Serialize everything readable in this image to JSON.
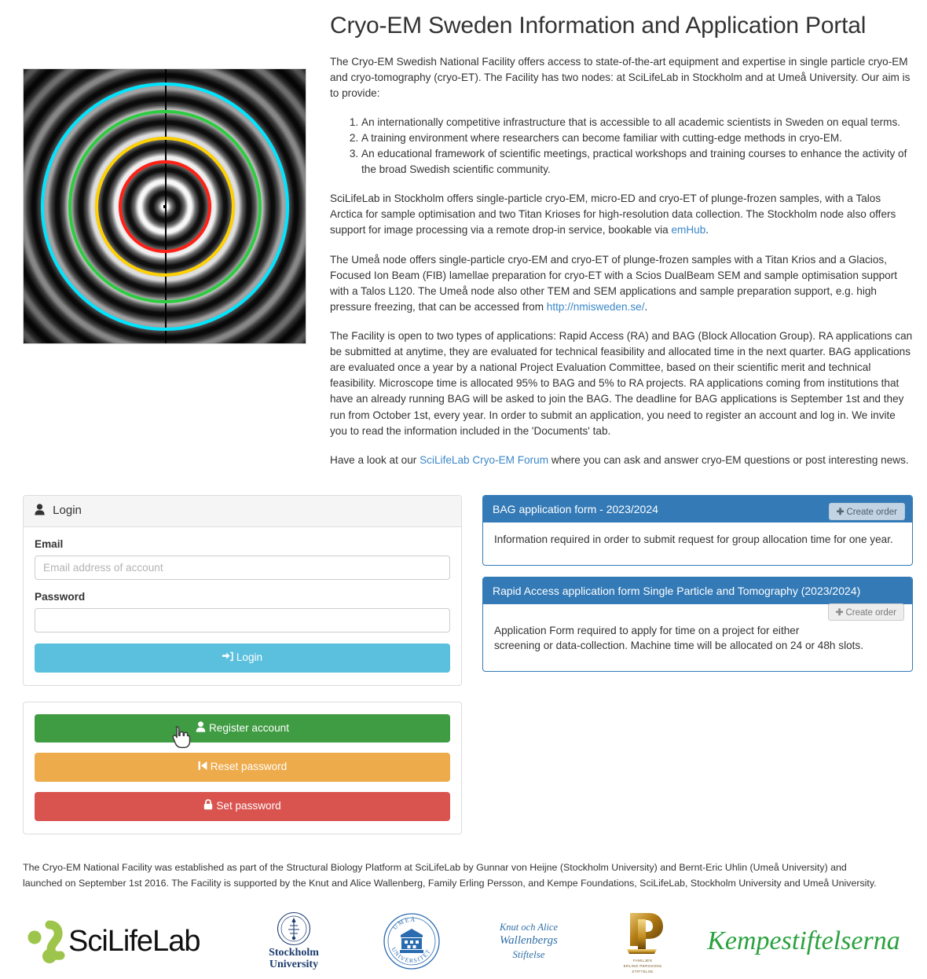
{
  "header": {
    "title": "Cryo-EM Sweden Information and Application Portal"
  },
  "intro": {
    "paragraph1": "The Cryo-EM Swedish National Facility offers access to state-of-the-art equipment and expertise in single particle cryo-EM and cryo-tomography (cryo-ET). The Facility has two nodes: at SciLifeLab in Stockholm and at Umeå University. Our aim is to provide:",
    "aims": [
      "An internationally competitive infrastructure that is accessible to all academic scientists in Sweden on equal terms.",
      "A training environment where researchers can become familiar with cutting-edge methods in cryo-EM.",
      "An educational framework of scientific meetings, practical workshops and training courses to enhance the activity of the broad Swedish scientific community."
    ],
    "stockholm_para_a": "SciLifeLab in Stockholm offers single-particle cryo-EM, micro-ED and cryo-ET of plunge-frozen samples, with a Talos Arctica for sample optimisation and two Titan Krioses for high-resolution data collection. The Stockholm node also offers support for image processing via a remote drop-in service, bookable via ",
    "stockholm_link": "emHub",
    "stockholm_para_b": ".",
    "umea_para_a": "The Umeå node offers single-particle cryo-EM and cryo-ET of plunge-frozen samples with a Titan Krios and a Glacios, Focused Ion Beam (FIB) lamellae preparation for cryo-ET with a Scios DualBeam SEM and sample optimisation support with a Talos L120. The Umeå node also other TEM and SEM applications and sample preparation support, e.g. high pressure freezing, that can be accessed from ",
    "umea_link": "http://nmisweden.se/",
    "umea_para_b": ".",
    "applications_para": "The Facility is open to two types of applications: Rapid Access (RA) and BAG (Block Allocation Group). RA applications can be submitted at anytime, they are evaluated for technical feasibility and allocated time in the next quarter. BAG applications are evaluated once a year by a national Project Evaluation Committee, based on their scientific merit and technical feasibility. Microscope time is allocated 95% to BAG and 5% to RA projects. RA applications coming from institutions that have an already running BAG will be asked to join the BAG. The deadline for BAG applications is September 1st and they run from October 1st, every year. In order to submit an application, you need to register an account and log in. We invite you to read the information included in the 'Documents' tab.",
    "forum_para_a": "Have a look at our ",
    "forum_link": "SciLifeLab Cryo-EM Forum",
    "forum_para_b": " where you can ask and answer cryo-EM questions or post interesting news."
  },
  "ctf_image": {
    "alt": "CTF Thon rings power spectrum with resolution rings",
    "ring_colors": [
      "#00e5ff",
      "#2ecc40",
      "#ffd000",
      "#ff2016"
    ]
  },
  "login_panel": {
    "heading": "Login",
    "heading_icon": "user-icon",
    "email_label": "Email",
    "email_placeholder": "Email address of account",
    "email_value": "",
    "password_label": "Password",
    "password_value": "",
    "login_button": "Login",
    "login_button_icon": "sign-in-icon",
    "login_button_color": "#5bc0de"
  },
  "account_actions": {
    "register": {
      "label": "Register account",
      "icon": "user-icon",
      "color": "#3f9c42"
    },
    "reset": {
      "label": "Reset password",
      "icon": "step-backward-icon",
      "color": "#eeab4c"
    },
    "set": {
      "label": "Set password",
      "icon": "lock-icon",
      "color": "#d9534f"
    }
  },
  "order_forms": [
    {
      "title": "BAG application form - 2023/2024",
      "description": "Information required in order to submit request for group allocation time for one year.",
      "create_label": "Create order",
      "create_icon": "plus-icon"
    },
    {
      "title": "Rapid Access application form Single Particle and Tomography (2023/2024)",
      "description_line1": "Application Form required to apply for time on a project for either",
      "description_line2": "screening or data-collection. Machine time will be allocated on 24 or 48h slots.",
      "create_label": "Create order",
      "create_icon": "plus-icon"
    }
  ],
  "footer": {
    "text": "The Cryo-EM National Facility was established as part of the Structural Biology Platform at SciLifeLab by Gunnar von Heijne (Stockholm University) and Bernt-Eric Uhlin (Umeå University) and launched on September 1st 2016. The Facility is supported by the Knut and Alice Wallenberg, Family Erling Persson, and Kempe Foundations, SciLifeLab, Stockholm University and Umeå University.",
    "logos": [
      {
        "name": "scilifelab-logo",
        "text": "SciLifeLab"
      },
      {
        "name": "stockholm-university-logo",
        "line1": "Stockholm",
        "line2": "University"
      },
      {
        "name": "umea-university-logo",
        "top": "UMEÅ",
        "bottom": "UNIVERSITET"
      },
      {
        "name": "knut-alice-wallenberg-logo",
        "line1": "Knut och Alice",
        "line2": "Wallenbergs",
        "line3": "Stiftelse"
      },
      {
        "name": "family-erling-persson-logo",
        "mark": "P",
        "line1": "FAMILJEN",
        "line2": "ERLING-PERSSONS",
        "line3": "STIFTELSE"
      },
      {
        "name": "kempestiftelserna-logo",
        "text": "Kempestiftelserna"
      }
    ]
  },
  "colors": {
    "primary_blue": "#337ab7",
    "info_blue": "#5bc0de",
    "success_green": "#3f9c42",
    "warning_orange": "#eeab4c",
    "danger_red": "#d9534f",
    "link_blue": "#3a87c8"
  }
}
